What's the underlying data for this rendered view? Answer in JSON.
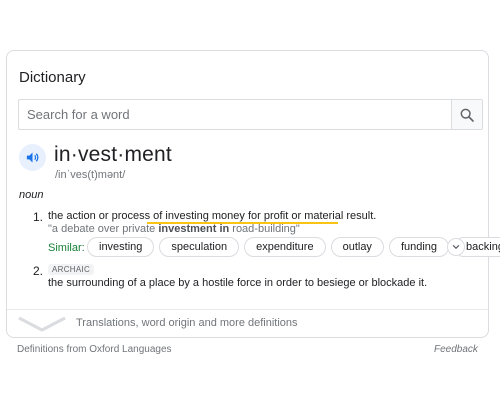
{
  "card": {
    "title": "Dictionary",
    "search": {
      "placeholder": "Search for a word",
      "value": ""
    },
    "entry": {
      "headword": "in·vest·ment",
      "phonetic": "/inˈves(t)mənt/",
      "part_of_speech": "noun",
      "senses": [
        {
          "number": "1.",
          "definition_before": "the action or process of ",
          "definition_highlight": "investing money for profit or material result.",
          "example": "\"a debate over private ",
          "example_bold": "investment in",
          "example_after": " road-building\"",
          "similar_label": "Similar:",
          "similar": [
            "investing",
            "speculation",
            "expenditure",
            "outlay",
            "funding",
            "backing"
          ]
        },
        {
          "number": "2.",
          "label": "ARCHAIC",
          "definition": "the surrounding of a place by a hostile force in order to besiege or blockade it."
        }
      ]
    },
    "more_text": "Translations, word origin and more definitions"
  },
  "footer": {
    "source": "Definitions from Oxford Languages",
    "feedback": "Feedback"
  },
  "colors": {
    "accent_blue": "#1a73e8",
    "highlight": "#f9c413",
    "similar_green": "#188038"
  },
  "icons": {
    "search": "search-icon",
    "audio": "speaker-icon",
    "more_similar": "chevron-down-icon",
    "expand": "chevron-down-icon"
  }
}
